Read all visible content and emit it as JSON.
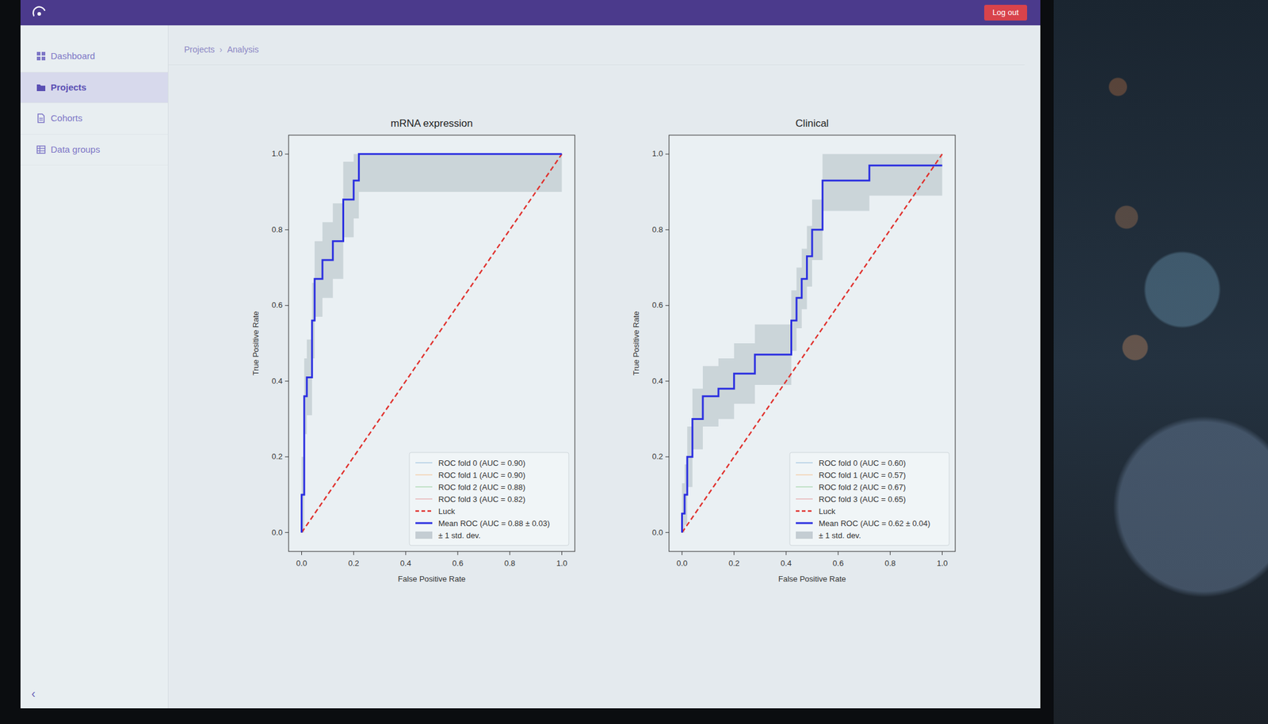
{
  "app": {
    "logout": "Log out"
  },
  "sidebar": {
    "items": [
      {
        "label": "Dashboard",
        "selected": false
      },
      {
        "label": "Projects",
        "selected": true
      },
      {
        "label": "Cohorts",
        "selected": false
      },
      {
        "label": "Data groups",
        "selected": false
      }
    ],
    "collapse": "‹"
  },
  "breadcrumb": {
    "items": [
      "Projects",
      "Analysis"
    ],
    "separator": "›"
  },
  "charts": [
    {
      "title": "mRNA expression",
      "y_label": "True Positive Rate",
      "x_label": "False Positive Rate",
      "x_ticks": [
        "0.0",
        "0.2",
        "0.4",
        "0.6",
        "0.8",
        "1.0"
      ],
      "y_ticks": [
        "0.0",
        "0.2",
        "0.4",
        "0.6",
        "0.8",
        "1.0"
      ],
      "legend": [
        {
          "label": "ROC fold 0 (AUC = 0.90)",
          "kind": "fold",
          "color": "#1f77b4"
        },
        {
          "label": "ROC fold 1 (AUC = 0.90)",
          "kind": "fold",
          "color": "#ff7f0e"
        },
        {
          "label": "ROC fold 2 (AUC = 0.88)",
          "kind": "fold",
          "color": "#2ca02c"
        },
        {
          "label": "ROC fold 3 (AUC = 0.82)",
          "kind": "fold",
          "color": "#d62728"
        },
        {
          "label": "Luck",
          "kind": "luck",
          "color": "#e0302c"
        },
        {
          "label": "Mean ROC (AUC = 0.88 ± 0.03)",
          "kind": "mean",
          "color": "#2b2fe0"
        },
        {
          "label": "± 1 std. dev.",
          "kind": "band",
          "color": "#a7b3ba"
        }
      ],
      "luck": {
        "fpr": [
          0,
          1
        ],
        "tpr": [
          0,
          1
        ]
      },
      "mean": {
        "fpr": [
          0,
          0,
          0.01,
          0.01,
          0.02,
          0.02,
          0.04,
          0.04,
          0.05,
          0.05,
          0.08,
          0.08,
          0.12,
          0.12,
          0.16,
          0.16,
          0.2,
          0.2,
          0.22,
          0.22,
          1.0
        ],
        "tpr": [
          0,
          0.1,
          0.1,
          0.36,
          0.36,
          0.41,
          0.41,
          0.56,
          0.56,
          0.67,
          0.67,
          0.72,
          0.72,
          0.77,
          0.77,
          0.88,
          0.88,
          0.93,
          0.93,
          1.0,
          1.0
        ]
      },
      "std": 0.1
    },
    {
      "title": "Clinical",
      "y_label": "True Positive Rate",
      "x_label": "False Positive Rate",
      "x_ticks": [
        "0.0",
        "0.2",
        "0.4",
        "0.6",
        "0.8",
        "1.0"
      ],
      "y_ticks": [
        "0.0",
        "0.2",
        "0.4",
        "0.6",
        "0.8",
        "1.0"
      ],
      "legend": [
        {
          "label": "ROC fold 0 (AUC = 0.60)",
          "kind": "fold",
          "color": "#1f77b4"
        },
        {
          "label": "ROC fold 1 (AUC = 0.57)",
          "kind": "fold",
          "color": "#ff7f0e"
        },
        {
          "label": "ROC fold 2 (AUC = 0.67)",
          "kind": "fold",
          "color": "#2ca02c"
        },
        {
          "label": "ROC fold 3 (AUC = 0.65)",
          "kind": "fold",
          "color": "#d62728"
        },
        {
          "label": "Luck",
          "kind": "luck",
          "color": "#e0302c"
        },
        {
          "label": "Mean ROC (AUC = 0.62 ± 0.04)",
          "kind": "mean",
          "color": "#2b2fe0"
        },
        {
          "label": "± 1 std. dev.",
          "kind": "band",
          "color": "#a7b3ba"
        }
      ],
      "luck": {
        "fpr": [
          0,
          1
        ],
        "tpr": [
          0,
          1
        ]
      },
      "mean": {
        "fpr": [
          0,
          0,
          0.01,
          0.01,
          0.02,
          0.02,
          0.04,
          0.04,
          0.08,
          0.08,
          0.14,
          0.14,
          0.2,
          0.2,
          0.28,
          0.28,
          0.42,
          0.42,
          0.44,
          0.44,
          0.46,
          0.46,
          0.48,
          0.48,
          0.5,
          0.5,
          0.54,
          0.54,
          0.72,
          0.72,
          1.0
        ],
        "tpr": [
          0,
          0.05,
          0.05,
          0.1,
          0.1,
          0.2,
          0.2,
          0.3,
          0.3,
          0.36,
          0.36,
          0.38,
          0.38,
          0.42,
          0.42,
          0.47,
          0.47,
          0.56,
          0.56,
          0.62,
          0.62,
          0.67,
          0.67,
          0.73,
          0.73,
          0.8,
          0.8,
          0.93,
          0.93,
          0.97,
          0.97
        ]
      },
      "std": 0.08
    }
  ]
}
